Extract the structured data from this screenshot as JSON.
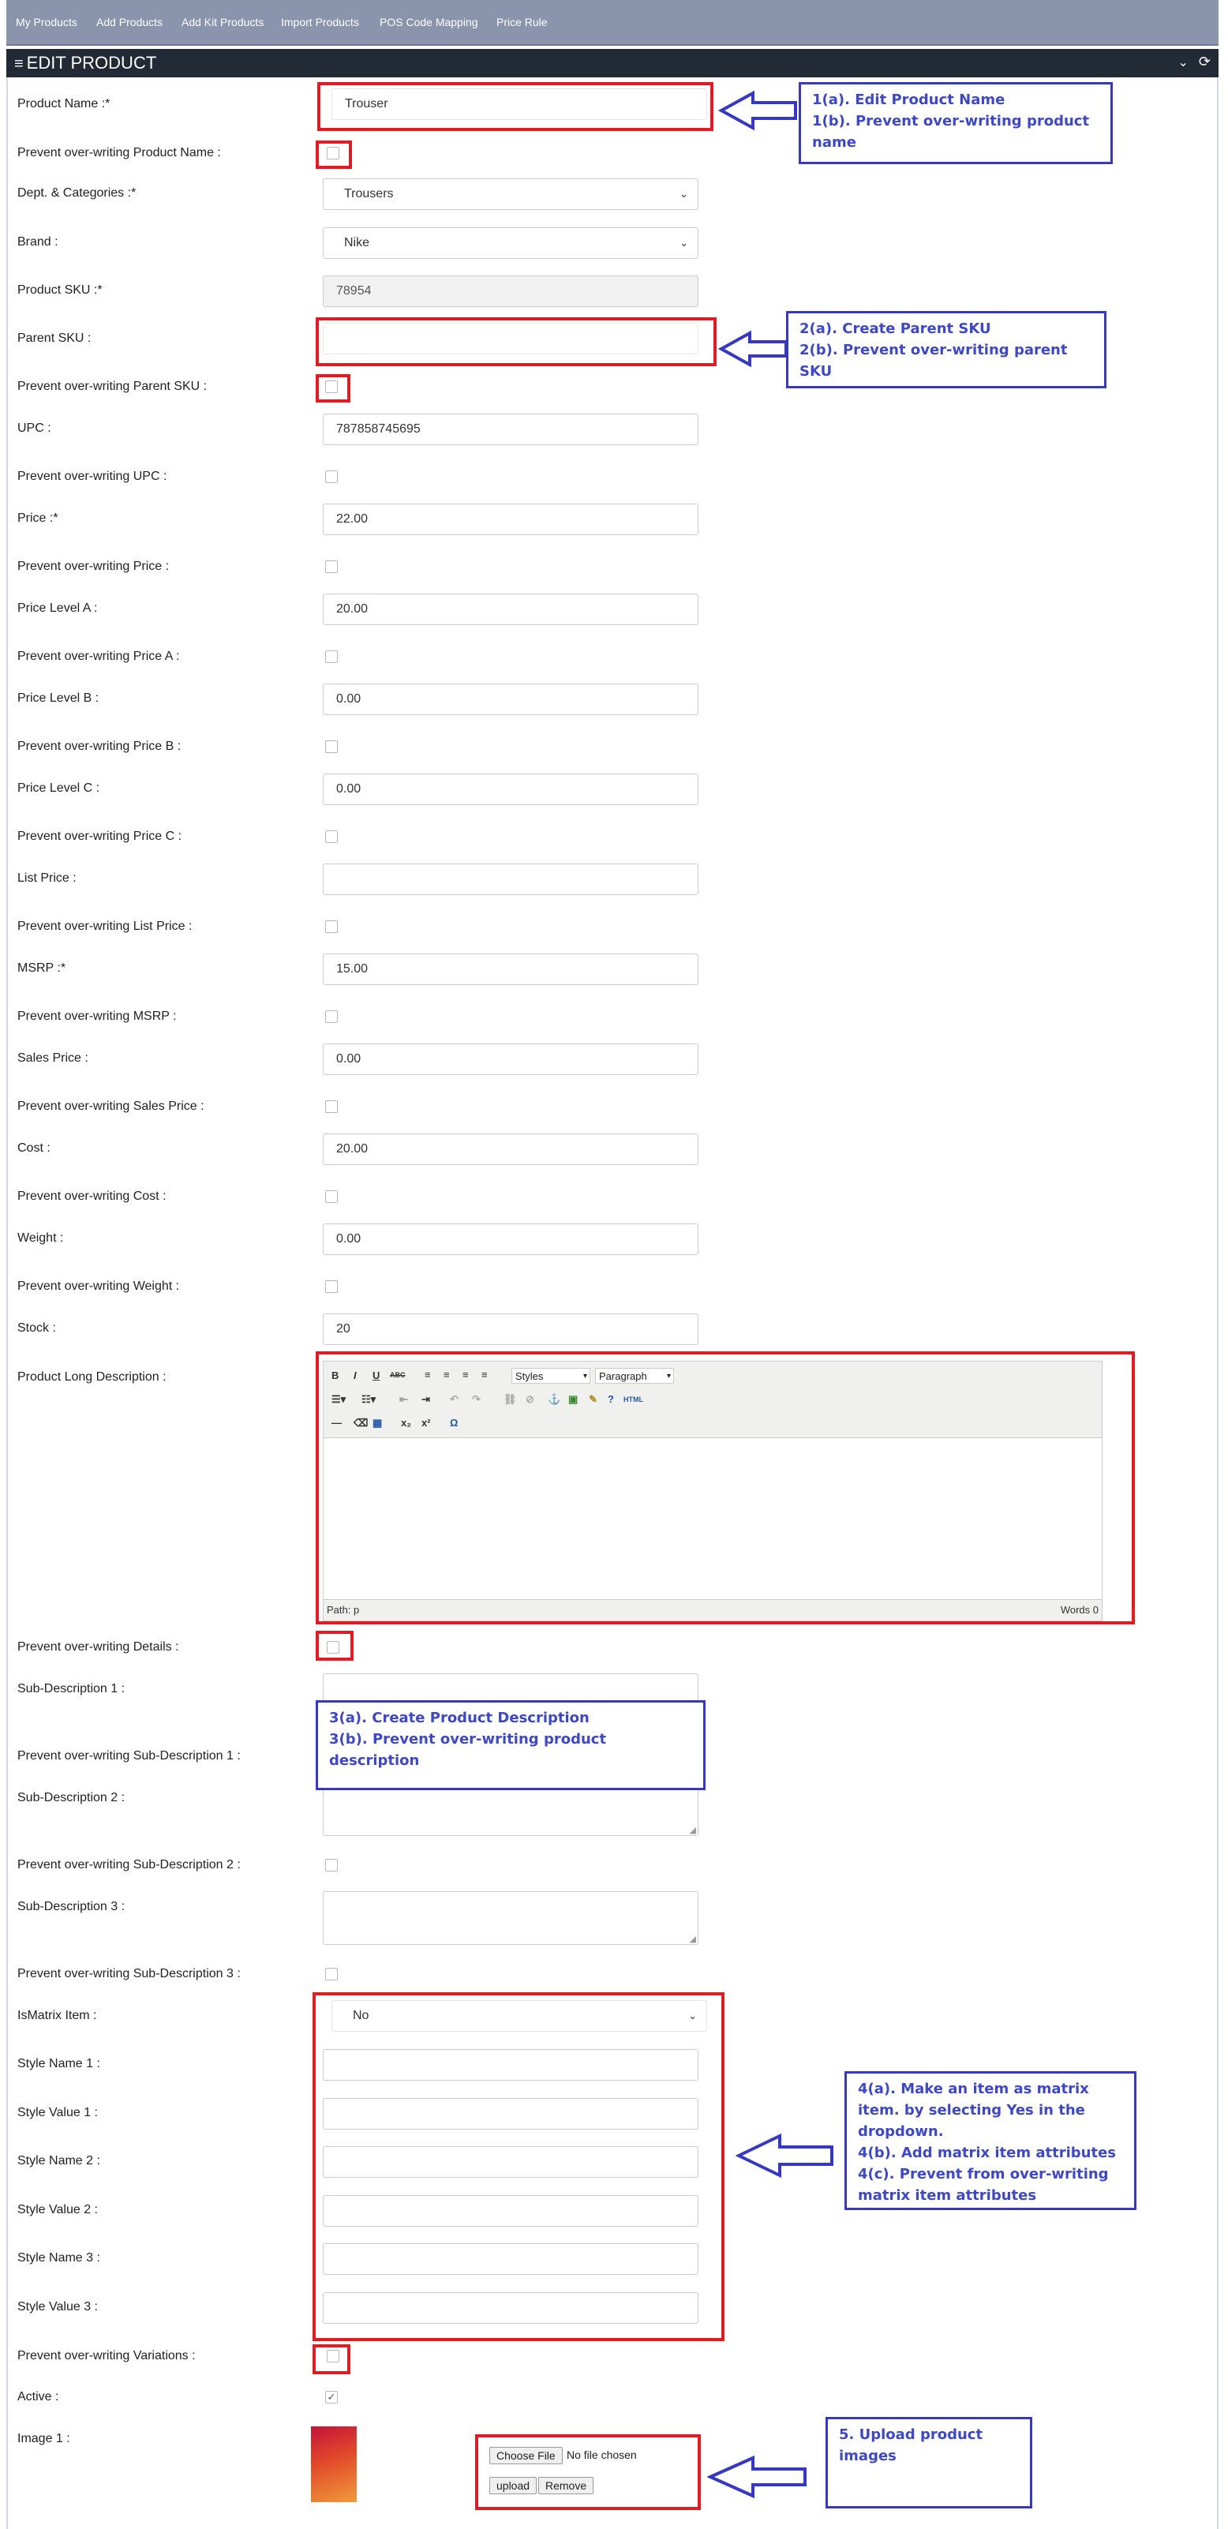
{
  "topnav": {
    "items": [
      "My Products",
      "Add Products",
      "Add Kit Products",
      "Import Products",
      "POS Code Mapping",
      "Price Rule"
    ]
  },
  "header": {
    "title": "EDIT PRODUCT"
  },
  "form": {
    "product_name": {
      "label": "Product Name :*",
      "value": "Trouser"
    },
    "prevent_product_name": {
      "label": "Prevent over-writing Product Name :"
    },
    "dept": {
      "label": "Dept. & Categories :*",
      "value": "Trousers"
    },
    "brand": {
      "label": "Brand :",
      "value": "Nike"
    },
    "sku": {
      "label": "Product SKU :*",
      "value": "78954"
    },
    "parent_sku": {
      "label": "Parent SKU :",
      "value": ""
    },
    "prevent_parent_sku": {
      "label": "Prevent over-writing Parent SKU :"
    },
    "upc": {
      "label": "UPC :",
      "value": "787858745695"
    },
    "prevent_upc": {
      "label": "Prevent over-writing UPC :"
    },
    "price": {
      "label": "Price :*",
      "value": "22.00"
    },
    "prevent_price": {
      "label": "Prevent over-writing Price :"
    },
    "price_a": {
      "label": "Price Level A :",
      "value": "20.00"
    },
    "prevent_price_a": {
      "label": "Prevent over-writing Price A :"
    },
    "price_b": {
      "label": "Price Level B :",
      "value": "0.00"
    },
    "prevent_price_b": {
      "label": "Prevent over-writing Price B :"
    },
    "price_c": {
      "label": "Price Level C :",
      "value": "0.00"
    },
    "prevent_price_c": {
      "label": "Prevent over-writing Price C :"
    },
    "list_price": {
      "label": "List Price :",
      "value": ""
    },
    "prevent_list_price": {
      "label": "Prevent over-writing List Price :"
    },
    "msrp": {
      "label": "MSRP :*",
      "value": "15.00"
    },
    "prevent_msrp": {
      "label": "Prevent over-writing MSRP :"
    },
    "sales_price": {
      "label": "Sales Price :",
      "value": "0.00"
    },
    "prevent_sales_price": {
      "label": "Prevent over-writing Sales Price :"
    },
    "cost": {
      "label": "Cost :",
      "value": "20.00"
    },
    "prevent_cost": {
      "label": "Prevent over-writing Cost :"
    },
    "weight": {
      "label": "Weight :",
      "value": "0.00"
    },
    "prevent_weight": {
      "label": "Prevent over-writing Weight :"
    },
    "stock": {
      "label": "Stock :",
      "value": "20"
    },
    "long_desc": {
      "label": "Product Long Description :"
    },
    "prevent_details": {
      "label": "Prevent over-writing Details :"
    },
    "sub_desc_1": {
      "label": "Sub-Description 1 :"
    },
    "prevent_sub_desc_1": {
      "label": "Prevent over-writing Sub-Description 1 :"
    },
    "sub_desc_2": {
      "label": "Sub-Description 2 :"
    },
    "prevent_sub_desc_2": {
      "label": "Prevent over-writing Sub-Description 2 :"
    },
    "sub_desc_3": {
      "label": "Sub-Description 3 :"
    },
    "prevent_sub_desc_3": {
      "label": "Prevent over-writing Sub-Description 3 :"
    },
    "is_matrix": {
      "label": "IsMatrix Item :",
      "value": "No"
    },
    "style_name_1": {
      "label": "Style Name 1 :"
    },
    "style_value_1": {
      "label": "Style Value 1 :"
    },
    "style_name_2": {
      "label": "Style Name 2 :"
    },
    "style_value_2": {
      "label": "Style Value 2 :"
    },
    "style_name_3": {
      "label": "Style Name 3 :"
    },
    "style_value_3": {
      "label": "Style Value 3 :"
    },
    "prevent_variations": {
      "label": "Prevent over-writing Variations :"
    },
    "active": {
      "label": "Active :",
      "checked": true
    },
    "image1": {
      "label": "Image 1 :",
      "choose_file": "Choose File",
      "no_file": "No file chosen",
      "upload": "upload",
      "remove": "Remove"
    }
  },
  "editor": {
    "styles": "Styles",
    "paragraph": "Paragraph",
    "path": "Path: p",
    "words": "Words 0",
    "buttons": {
      "bold": "B",
      "italic": "I",
      "underline": "U",
      "strike": "ABC",
      "omega": "Ω",
      "html": "HTML",
      "sub": "x₂",
      "sup": "x²"
    }
  },
  "annotations": {
    "a1": [
      "1(a). Edit Product Name",
      "1(b). Prevent over-writing product name"
    ],
    "a2": [
      "2(a). Create Parent SKU",
      "2(b). Prevent over-writing parent SKU"
    ],
    "a3": [
      "3(a). Create Product Description",
      "3(b). Prevent over-writing product description"
    ],
    "a4": [
      "4(a). Make an item as matrix item. by selecting Yes in the dropdown.",
      "4(b). Add matrix item attributes",
      "4(c). Prevent from over-writing matrix item attributes"
    ],
    "a5": [
      "5. Upload product images"
    ]
  },
  "colors": {
    "nav": "#8a94ad",
    "titlebar": "#222a35",
    "annotation_red": "#e01b24",
    "annotation_blue": "#3438c2"
  }
}
